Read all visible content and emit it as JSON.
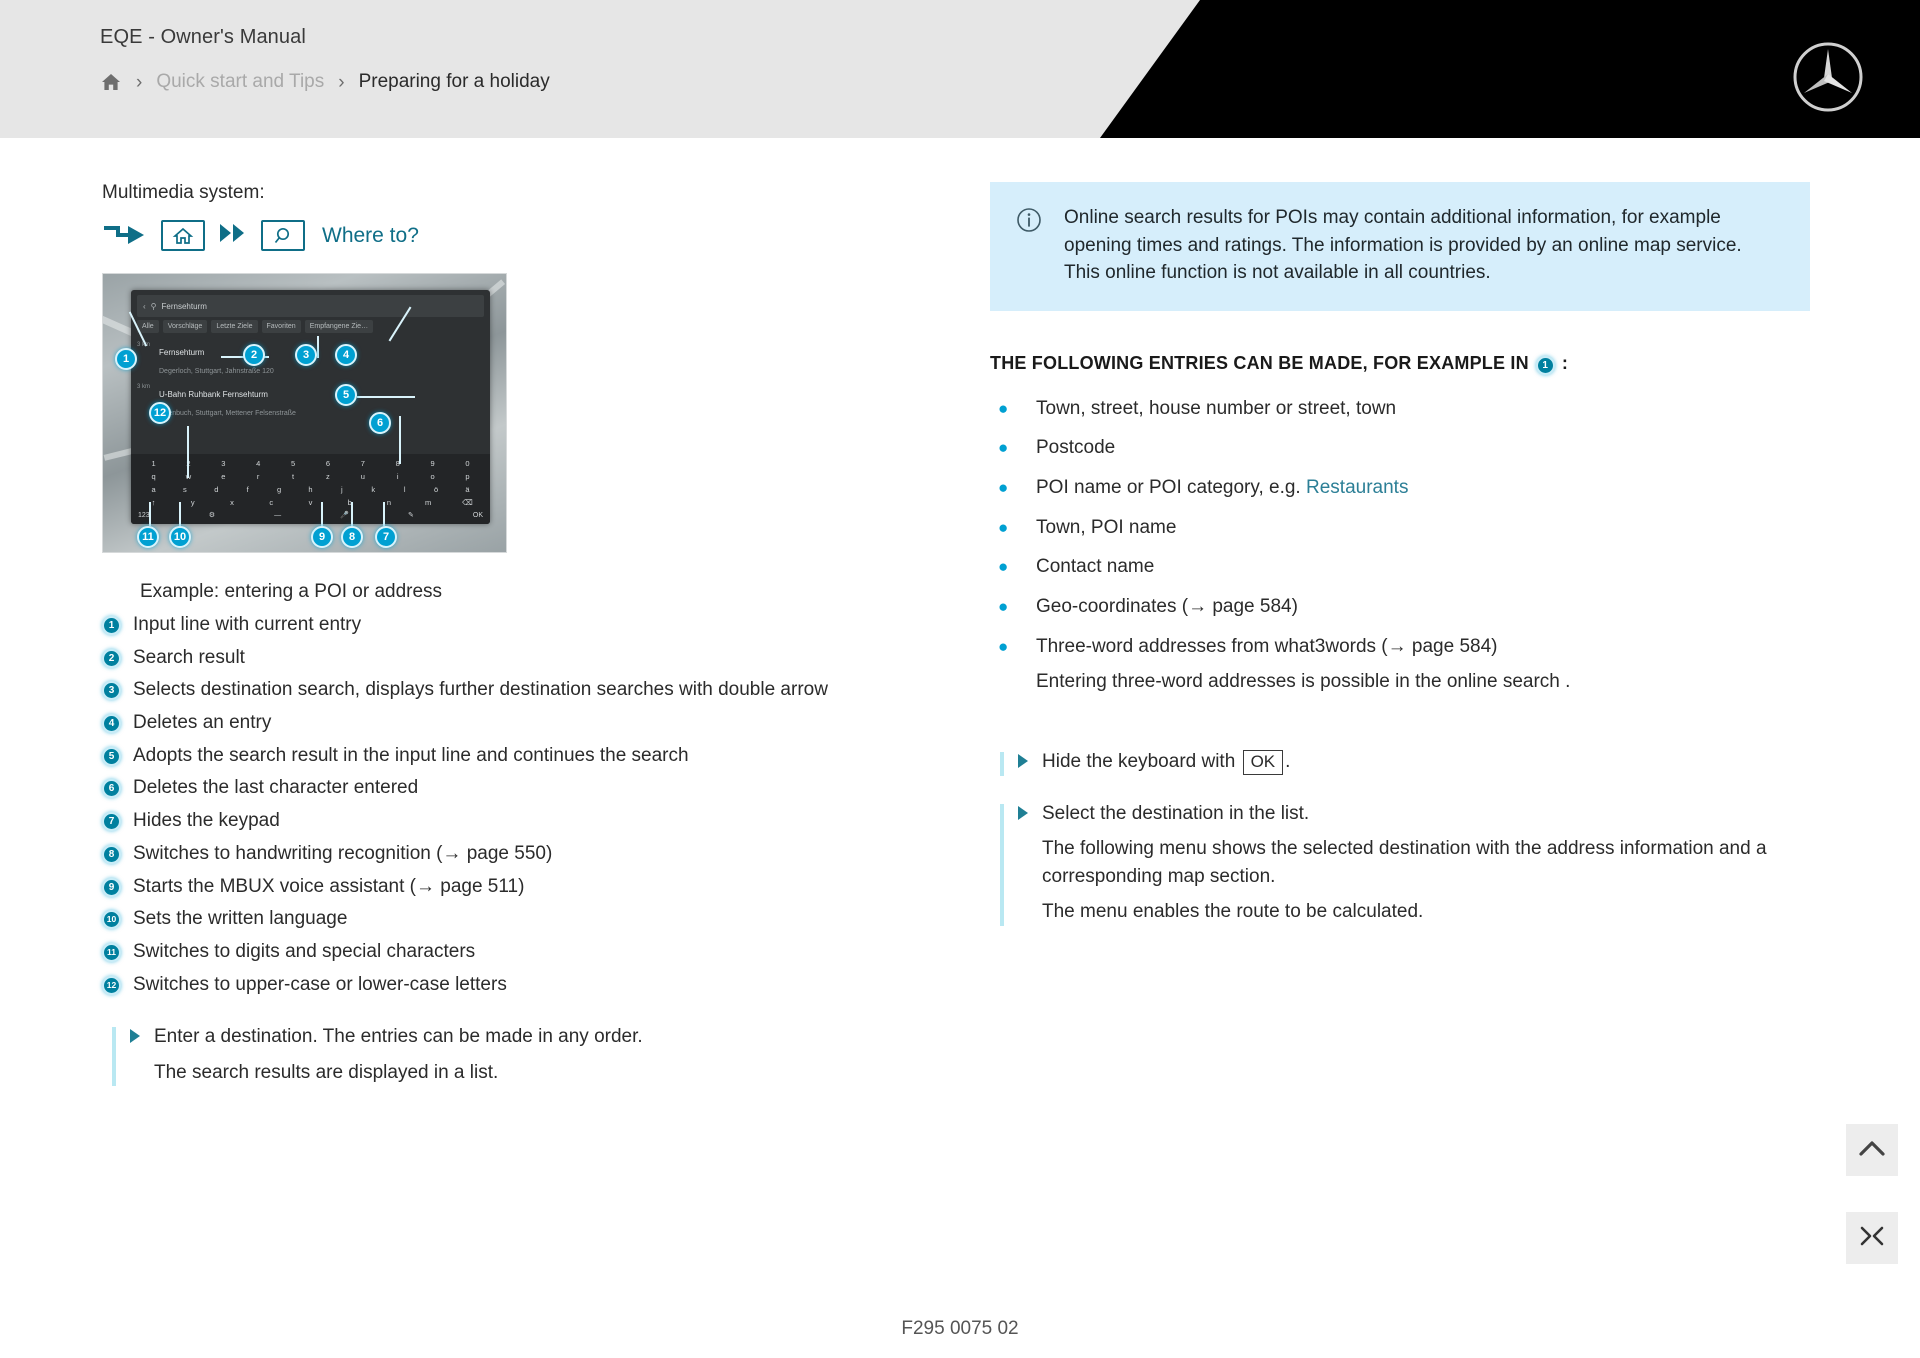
{
  "header": {
    "manual_title": "EQE - Owner's Manual",
    "home_icon": "home-icon",
    "separator": "›",
    "breadcrumb": [
      {
        "label": "Quick start and Tips",
        "state": "muted"
      },
      {
        "label": "Preparing for a holiday",
        "state": "active"
      }
    ],
    "brand_logo": "mercedes-star-icon"
  },
  "left": {
    "lead": "Multimedia system:",
    "path_icons": [
      "step-arrow-icon",
      "home-icon",
      "double-chevron-icon",
      "search-magnifier-icon"
    ],
    "path_label": "Where to?",
    "screenshot": {
      "search_value": "Fernsehturm",
      "search_icon": "search-magnifier-icon",
      "back_icon": "chevron-left-icon",
      "clear_icon": "close-circle-icon",
      "tabs": [
        "Alle",
        "Vorschläge",
        "Letzte Ziele",
        "Favoriten",
        "Empfangene Zie…"
      ],
      "results": [
        {
          "distance": "3 km",
          "title": "Fernsehturm",
          "subtitle": "Degerloch, Stuttgart, Jahnstraße 120"
        },
        {
          "distance": "3 km",
          "title": "U-Bahn Ruhbank Fernsehturm",
          "subtitle": "Sillenbuch, Stuttgart, Mettener Felsenstraße"
        }
      ],
      "keyboard": {
        "row_numbers": [
          "1",
          "2",
          "3",
          "4",
          "5",
          "6",
          "7",
          "8",
          "9",
          "0"
        ],
        "row_1": [
          "q",
          "w",
          "e",
          "r",
          "t",
          "z",
          "u",
          "i",
          "o",
          "p"
        ],
        "row_2": [
          "a",
          "s",
          "d",
          "f",
          "g",
          "h",
          "j",
          "k",
          "l",
          "ö",
          "ä"
        ],
        "row_3": [
          "↑",
          "y",
          "x",
          "c",
          "v",
          "b",
          "n",
          "m",
          "⌫"
        ],
        "bottom": [
          "123",
          "⚙",
          "—",
          "🎤",
          "✎",
          "OK"
        ]
      },
      "callouts": [
        "1",
        "2",
        "3",
        "4",
        "5",
        "6",
        "7",
        "8",
        "9",
        "10",
        "11",
        "12"
      ]
    },
    "example_caption": "Example: entering a POI or address",
    "legend": [
      {
        "num": "1",
        "text": "Input line with current entry"
      },
      {
        "num": "2",
        "text": "Search result"
      },
      {
        "num": "3",
        "text": "Selects destination search, displays further destination searches with double arrow"
      },
      {
        "num": "4",
        "text": "Deletes an entry"
      },
      {
        "num": "5",
        "text": "Adopts the search result in the input line and continues the search"
      },
      {
        "num": "6",
        "text": "Deletes the last character entered"
      },
      {
        "num": "7",
        "text": "Hides the keypad"
      },
      {
        "num": "8",
        "text": "Switches to handwriting recognition (→ page 550)"
      },
      {
        "num": "9",
        "text": "Starts the MBUX voice assistant (→ page 511)"
      },
      {
        "num": "10",
        "text": "Sets the written language"
      },
      {
        "num": "11",
        "text": "Switches to digits and special characters"
      },
      {
        "num": "12",
        "text": "Switches to upper-case or lower-case letters"
      }
    ],
    "action": {
      "arrow_icon": "play-triangle-icon",
      "lines": [
        "Enter a destination. The entries can be made in any order.",
        "The search results are displayed in a list."
      ]
    }
  },
  "right": {
    "infobox": {
      "icon": "info-circle-icon",
      "paragraph_1": "Online search results for POIs may contain additional information, for example opening times and ratings. The information is provided by an online map service.",
      "paragraph_2": "This online function is not available in all countries."
    },
    "section_heading_pre": "THE FOLLOWING ENTRIES CAN BE MADE, FOR EXAMPLE IN",
    "section_heading_badge": "1",
    "section_heading_post": ":",
    "bullets": [
      {
        "text": "Town, street, house number or street, town"
      },
      {
        "text": "Postcode"
      },
      {
        "text": "POI name or POI category, e.g. ",
        "link": "Restaurants"
      },
      {
        "text": "Town, POI name"
      },
      {
        "text": "Contact name"
      },
      {
        "text": "Geo-coordinates (→ page 584)"
      },
      {
        "text": "Three-word addresses from what3words (→ page 584)"
      }
    ],
    "bullet_note": "Entering three-word addresses is possible in the online search .",
    "actions": [
      {
        "arrow_icon": "play-triangle-icon",
        "pre": "Hide the keyboard with ",
        "key": "OK",
        "post": ".",
        "lines": []
      },
      {
        "arrow_icon": "play-triangle-icon",
        "pre": "Select the destination in the list.",
        "key": "",
        "post": "",
        "lines": [
          "The following menu shows the selected destination with the address information and a corresponding map section.",
          "The menu enables the route to be calculated."
        ]
      }
    ]
  },
  "footer": {
    "doc_code": "F295 0075 02",
    "scroll_top_icon": "chevron-up-icon",
    "collapse_icon": "collapse-arrows-icon"
  },
  "colors": {
    "accent_cyan": "#00a0d2",
    "accent_teal": "#0f6e87",
    "info_bg": "#d6eefb",
    "header_bg": "#e6e6e6",
    "rule_cyan": "#b9e8f2"
  }
}
